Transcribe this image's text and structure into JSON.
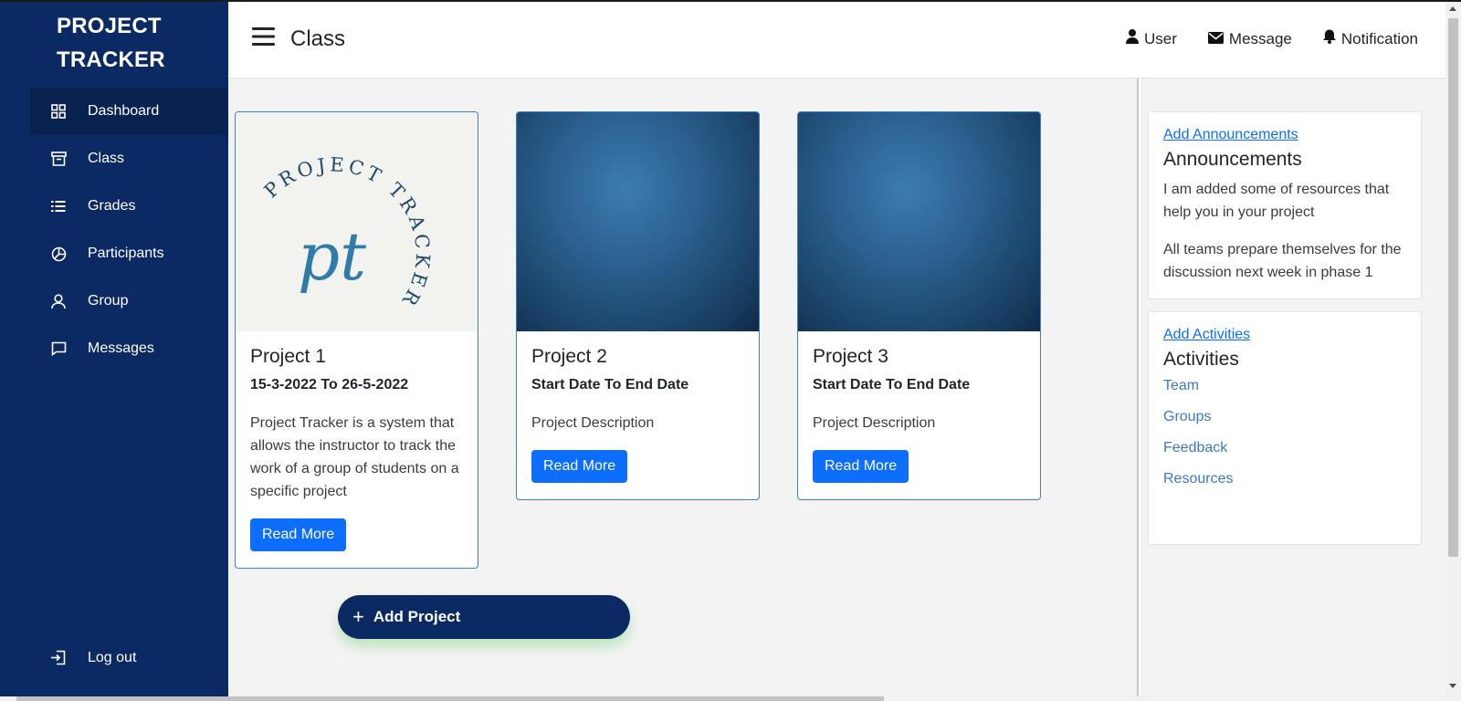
{
  "brand": {
    "line1": "PROJECT",
    "line2": "TRACKER"
  },
  "sidebar": {
    "items": [
      {
        "label": "Dashboard",
        "icon": "grid-icon",
        "active": true
      },
      {
        "label": "Class",
        "icon": "archive-icon"
      },
      {
        "label": "Grades",
        "icon": "list-icon"
      },
      {
        "label": "Participants",
        "icon": "pie-chart-icon"
      },
      {
        "label": "Group",
        "icon": "user-icon"
      },
      {
        "label": "Messages",
        "icon": "chat-icon"
      }
    ],
    "logout": "Log out"
  },
  "header": {
    "title": "Class",
    "links": {
      "user": "User",
      "message": "Message",
      "notification": "Notification"
    }
  },
  "projects": [
    {
      "title": "Project 1",
      "dates": "15-3-2022 To 26-5-2022",
      "description": "Project Tracker is a system that allows the instructor to track the work of a group of students on a specific project",
      "button": "Read More",
      "logo": {
        "mono": "pt",
        "ring_text": "PROJECT TRACKER"
      }
    },
    {
      "title": "Project 2",
      "dates": "Start Date To End Date",
      "description": "Project Description",
      "button": "Read More"
    },
    {
      "title": "Project 3",
      "dates": "Start Date To End Date",
      "description": "Project Description",
      "button": "Read More"
    }
  ],
  "add_project": "Add Project",
  "announcements": {
    "link": "Add Announcements",
    "title": "Announcements",
    "items": [
      "I am added some of resources that help you in your project",
      "All teams prepare themselves for the discussion next week in phase 1"
    ]
  },
  "activities": {
    "link": "Add Activities",
    "title": "Activities",
    "items": [
      "Team",
      "Groups",
      "Feedback",
      "Resources"
    ]
  },
  "colors": {
    "sidebar": "#0b2a63",
    "primary": "#0d6efd",
    "link": "#3c78c5"
  }
}
